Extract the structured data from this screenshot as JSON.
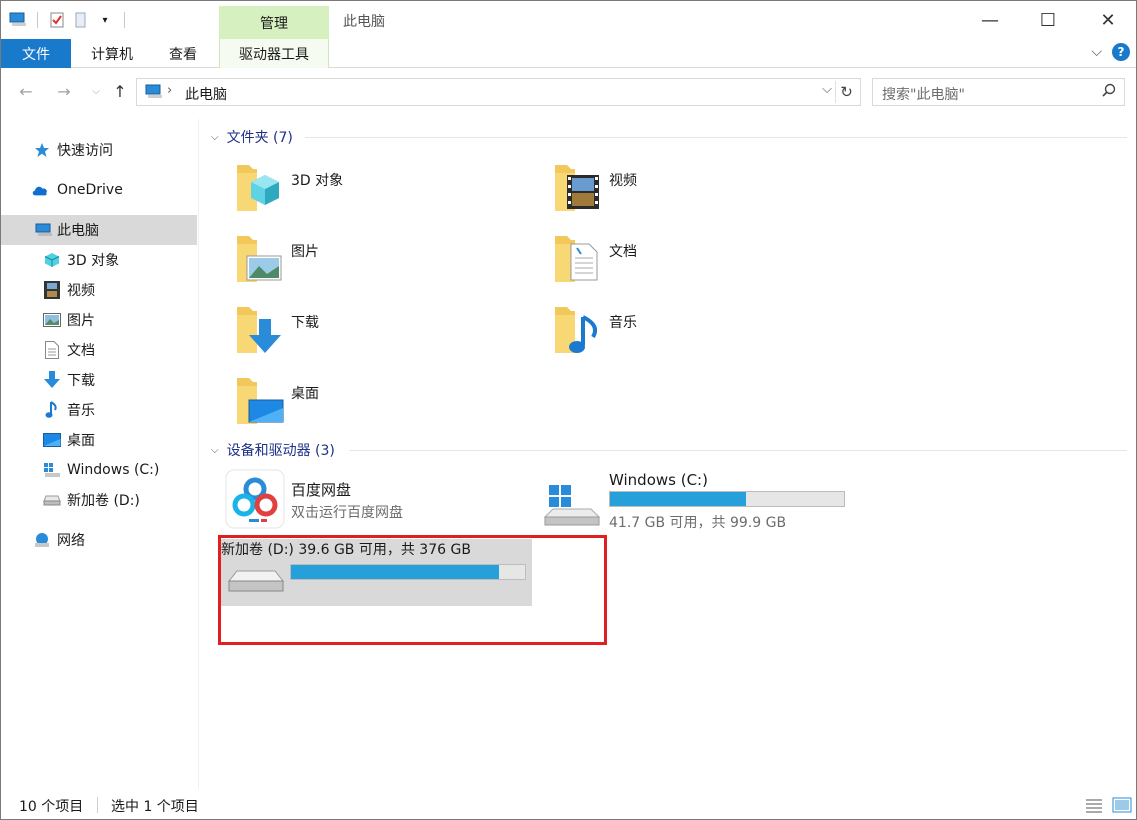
{
  "titlebar": {
    "manage_tab": "管理",
    "title": "此电脑",
    "minimize": "—",
    "maximize": "☐",
    "close": "✕"
  },
  "ribbon": {
    "file": "文件",
    "computer": "计算机",
    "view": "查看",
    "drive_tools": "驱动器工具"
  },
  "address": {
    "path": "此电脑",
    "search_placeholder": "搜索\"此电脑\""
  },
  "sidebar": {
    "items": [
      {
        "label": "快速访问",
        "icon": "star-icon"
      },
      {
        "label": "OneDrive",
        "icon": "cloud-icon"
      },
      {
        "label": "此电脑",
        "icon": "computer-icon"
      },
      {
        "label": "3D 对象",
        "icon": "cube-icon"
      },
      {
        "label": "视频",
        "icon": "video-icon"
      },
      {
        "label": "图片",
        "icon": "picture-icon"
      },
      {
        "label": "文档",
        "icon": "document-icon"
      },
      {
        "label": "下载",
        "icon": "download-icon"
      },
      {
        "label": "音乐",
        "icon": "music-icon"
      },
      {
        "label": "桌面",
        "icon": "desktop-icon"
      },
      {
        "label": "Windows (C:)",
        "icon": "windows-drive-icon"
      },
      {
        "label": "新加卷 (D:)",
        "icon": "drive-icon"
      },
      {
        "label": "网络",
        "icon": "network-icon"
      }
    ]
  },
  "folders_section": {
    "title": "文件夹 (7)",
    "items": [
      {
        "label": "3D 对象"
      },
      {
        "label": "视频"
      },
      {
        "label": "图片"
      },
      {
        "label": "文档"
      },
      {
        "label": "下载"
      },
      {
        "label": "音乐"
      },
      {
        "label": "桌面"
      }
    ]
  },
  "devices_section": {
    "title": "设备和驱动器 (3)",
    "baidu": {
      "label": "百度网盘",
      "sub": "双击运行百度网盘"
    },
    "c_drive": {
      "label": "Windows (C:)",
      "sub": "41.7 GB 可用，共 99.9 GB",
      "used_fraction": 0.58
    },
    "d_drive": {
      "label": "新加卷 (D:)",
      "sub": "39.6 GB 可用，共 376 GB",
      "used_fraction": 0.89
    }
  },
  "status": {
    "count": "10 个项目",
    "selected": "选中 1 个项目"
  },
  "colors": {
    "accent": "#1979ca",
    "bar_fill": "#26a0da",
    "highlight": "#e02020"
  }
}
